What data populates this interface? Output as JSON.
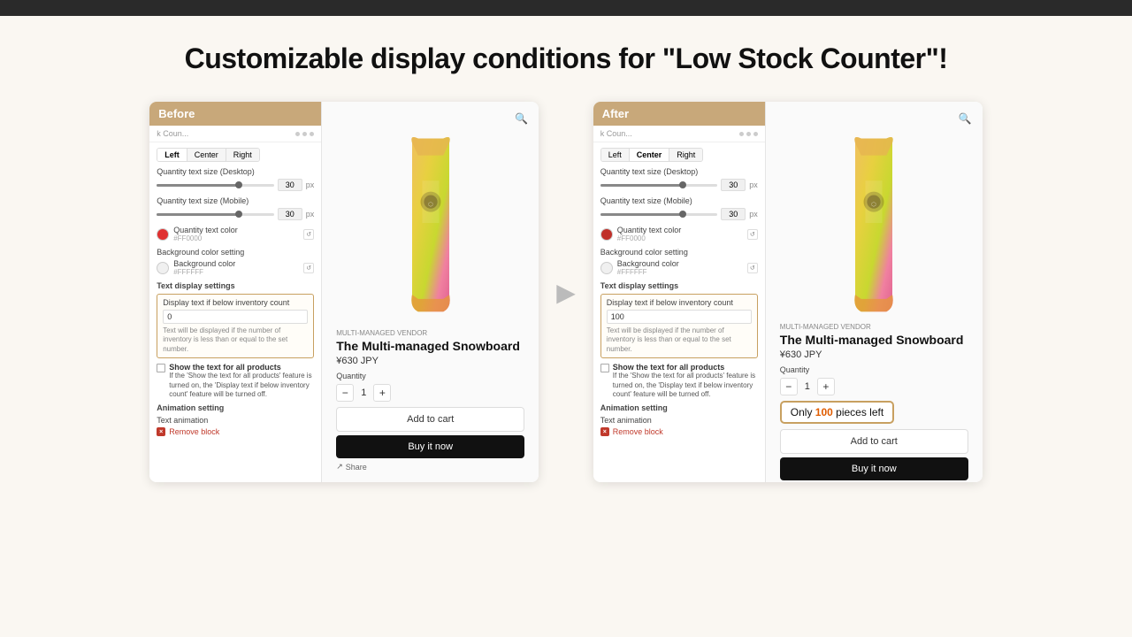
{
  "topBar": {},
  "headline": "Customizable display conditions for \"Low Stock Counter\"!",
  "before": {
    "badge": "Before",
    "topBarText": "k Coun...",
    "topBarSub": "k Counter",
    "alignButtons": [
      "Left",
      "Center",
      "Right"
    ],
    "activeAlign": "Center",
    "desktopSizeLabel": "Quantity text size (Desktop)",
    "desktopSizeValue": "30",
    "desktopSizeUnit": "px",
    "mobileSizeLabel": "Quantity text size (Mobile)",
    "mobileSizeValue": "30",
    "mobileSizeUnit": "px",
    "colorLabel": "Quantity text color",
    "colorHex": "#FF0000",
    "colorDotColor": "#e03030",
    "bgColorLabel": "Background color setting",
    "bgColorSub": "Background color",
    "bgColorHex": "#FFFFFF",
    "bgColorDotColor": "#f0f0f0",
    "textDisplayTitle": "Text display settings",
    "displayTextLabel": "Display text if below inventory count",
    "displayTextValue": "0",
    "helperText": "Text will be displayed if the number of inventory is less than or equal to the set number.",
    "checkboxLabel": "Show the text for all products",
    "checkboxHelp": "If the 'Show the text for all products' feature is turned on, the 'Display text if below inventory count' feature will be turned off.",
    "animationTitle": "Animation setting",
    "textAnimLabel": "Text animation",
    "removeLabel": "Remove block",
    "vendor": "MULTI-MANAGED VENDOR",
    "productTitle": "The Multi-managed Snowboard",
    "price": "¥630 JPY",
    "quantityLabel": "Quantity",
    "quantity": "1",
    "addToCart": "Add to cart",
    "buyNow": "Buy it now",
    "share": "Share"
  },
  "after": {
    "badge": "After",
    "topBarText": "k Coun...",
    "topBarSub": "k Counter",
    "alignButtons": [
      "Left",
      "Center",
      "Right"
    ],
    "activeAlign": "Center",
    "desktopSizeLabel": "Quantity text size (Desktop)",
    "desktopSizeValue": "30",
    "desktopSizeUnit": "px",
    "mobileSizeLabel": "Quantity text size (Mobile)",
    "mobileSizeValue": "30",
    "mobileSizeUnit": "px",
    "colorLabel": "Quantity text color",
    "colorHex": "#FF0000",
    "colorDotColor": "#c0302a",
    "bgColorLabel": "Background color setting",
    "bgColorSub": "Background color",
    "bgColorHex": "#FFFFFF",
    "bgColorDotColor": "#f0f0f0",
    "textDisplayTitle": "Text display settings",
    "displayTextLabel": "Display text if below inventory count",
    "displayTextValue": "100",
    "helperText": "Text will be displayed if the number of inventory is less than or equal to the set number.",
    "checkboxLabel": "Show the text for all products",
    "checkboxHelp": "If the 'Show the text for all products' feature is turned on, the 'Display text if below inventory count' feature will be turned off.",
    "animationTitle": "Animation setting",
    "textAnimLabel": "Text animation",
    "removeLabel": "Remove block",
    "vendor": "MULTI-MANAGED VENDOR",
    "productTitle": "The Multi-managed Snowboard",
    "price": "¥630 JPY",
    "quantityLabel": "Quantity",
    "quantity": "1",
    "lowStock": "Only ",
    "lowStockNum": "100",
    "lowStockSuffix": " pieces left",
    "addToCart": "Add to cart",
    "buyNow": "Buy it now"
  },
  "arrowSymbol": "▶"
}
